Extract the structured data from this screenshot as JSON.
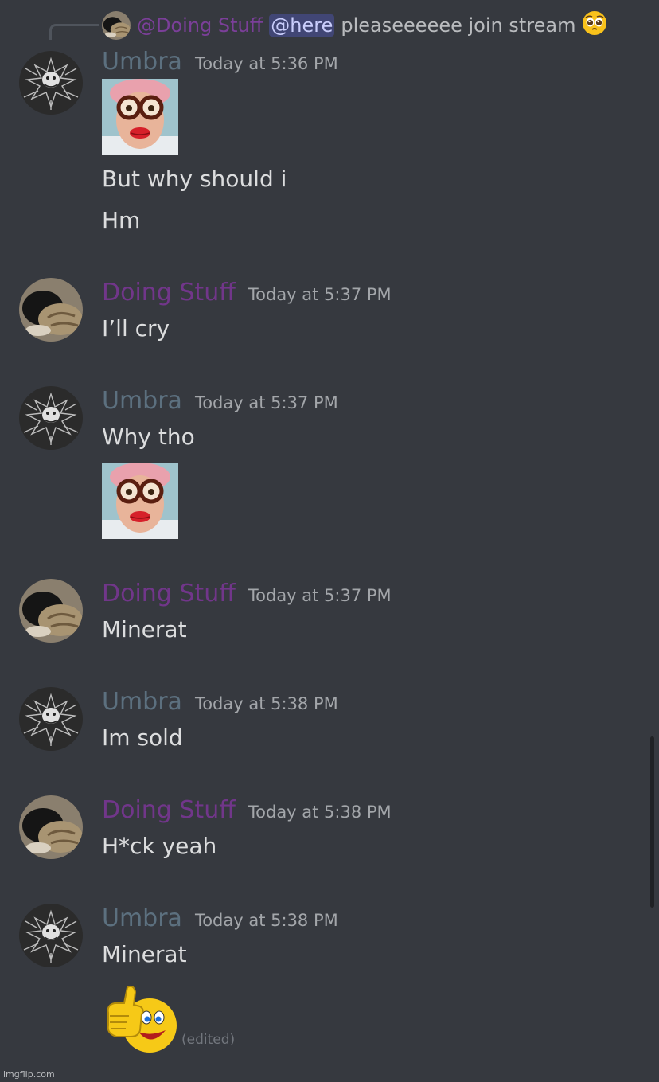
{
  "reply": {
    "author": "@Doing Stuff",
    "mention": "@here",
    "text": "pleaseeeeee join stream",
    "emoji": "pleading-face-emoji"
  },
  "messages": [
    {
      "author": "Umbra",
      "time": "Today at 5:36 PM",
      "lines": [
        "But why should i",
        "Hm"
      ],
      "images": [
        "grandma-glasses-image"
      ]
    },
    {
      "author": "Doing Stuff",
      "time": "Today at 5:37 PM",
      "lines": [
        "I’ll cry"
      ]
    },
    {
      "author": "Umbra",
      "time": "Today at 5:37 PM",
      "lines": [
        "Why tho"
      ],
      "images": [
        "grandma-glasses-image"
      ]
    },
    {
      "author": "Doing Stuff",
      "time": "Today at 5:37 PM",
      "lines": [
        "Minerat"
      ]
    },
    {
      "author": "Umbra",
      "time": "Today at 5:38 PM",
      "lines": [
        "Im sold"
      ]
    },
    {
      "author": "Doing Stuff",
      "time": "Today at 5:38 PM",
      "lines": [
        "H*ck yeah"
      ]
    },
    {
      "author": "Umbra",
      "time": "Today at 5:38 PM",
      "lines": [
        "Minerat"
      ],
      "images": [
        "thumbs-up-smiley-emoji"
      ],
      "edited": "(edited)"
    }
  ],
  "colors": {
    "background": "#36393f",
    "umbra_name": "#5c707f",
    "doing_stuff_name": "#71368a",
    "mention_bg": "#414675"
  },
  "watermark": "imgflip.com"
}
